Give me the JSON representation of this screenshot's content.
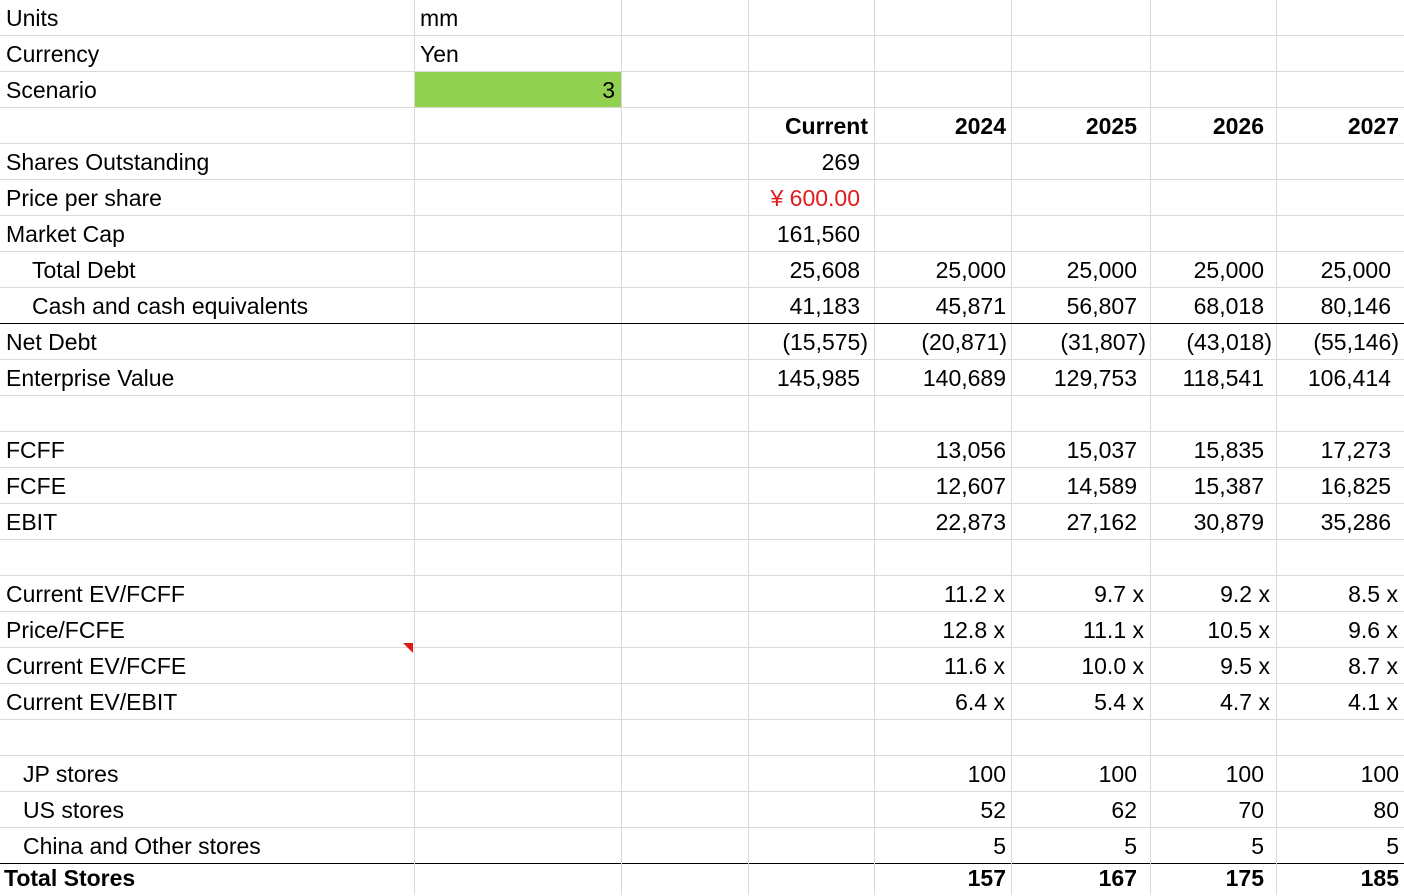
{
  "sheet": {
    "units_label": "Units",
    "units_value": "mm",
    "currency_label": "Currency",
    "currency_value": "Yen",
    "scenario_label": "Scenario",
    "scenario_value": "3",
    "headers": [
      "Current",
      "2024",
      "2025",
      "2026",
      "2027"
    ],
    "rows": {
      "shares": {
        "label": "Shares Outstanding",
        "current": "269"
      },
      "price": {
        "label": "Price per share",
        "current": "¥ 600.00"
      },
      "mcap": {
        "label": "Market Cap",
        "current": "161,560"
      },
      "debt": {
        "label": "Total Debt",
        "values": [
          "25,608",
          "25,000",
          "25,000",
          "25,000",
          "25,000"
        ]
      },
      "cash": {
        "label": "Cash and cash equivalents",
        "values": [
          "41,183",
          "45,871",
          "56,807",
          "68,018",
          "80,146"
        ]
      },
      "netdebt": {
        "label": "Net Debt",
        "values": [
          "(15,575)",
          "(20,871)",
          "(31,807)",
          "(43,018)",
          "(55,146)"
        ]
      },
      "ev": {
        "label": "Enterprise Value",
        "values": [
          "145,985",
          "140,689",
          "129,753",
          "118,541",
          "106,414"
        ]
      },
      "fcff": {
        "label": "FCFF",
        "values": [
          "13,056",
          "15,037",
          "15,835",
          "17,273"
        ]
      },
      "fcfe": {
        "label": "FCFE",
        "values": [
          "12,607",
          "14,589",
          "15,387",
          "16,825"
        ]
      },
      "ebit": {
        "label": "EBIT",
        "values": [
          "22,873",
          "27,162",
          "30,879",
          "35,286"
        ]
      },
      "ev_fcff": {
        "label": "Current EV/FCFF",
        "values": [
          "11.2 x",
          "9.7 x",
          "9.2 x",
          "8.5 x"
        ]
      },
      "p_fcfe": {
        "label": "Price/FCFE",
        "values": [
          "12.8 x",
          "11.1 x",
          "10.5 x",
          "9.6 x"
        ]
      },
      "ev_fcfe": {
        "label": "Current EV/FCFE",
        "values": [
          "11.6 x",
          "10.0 x",
          "9.5 x",
          "8.7 x"
        ]
      },
      "ev_ebit": {
        "label": "Current EV/EBIT",
        "values": [
          "6.4 x",
          "5.4 x",
          "4.7 x",
          "4.1 x"
        ]
      },
      "jp": {
        "label": "JP stores",
        "values": [
          "100",
          "100",
          "100",
          "100"
        ]
      },
      "us": {
        "label": "US stores",
        "values": [
          "52",
          "62",
          "70",
          "80"
        ]
      },
      "china": {
        "label": "China and Other stores",
        "values": [
          "5",
          "5",
          "5",
          "5"
        ]
      },
      "total": {
        "label": "Total Stores",
        "values": [
          "157",
          "167",
          "175",
          "185"
        ]
      }
    },
    "colors": {
      "scenario_fill": "#92d050",
      "price_text": "#e01b1b",
      "gridline": "#d9d9d9"
    }
  }
}
